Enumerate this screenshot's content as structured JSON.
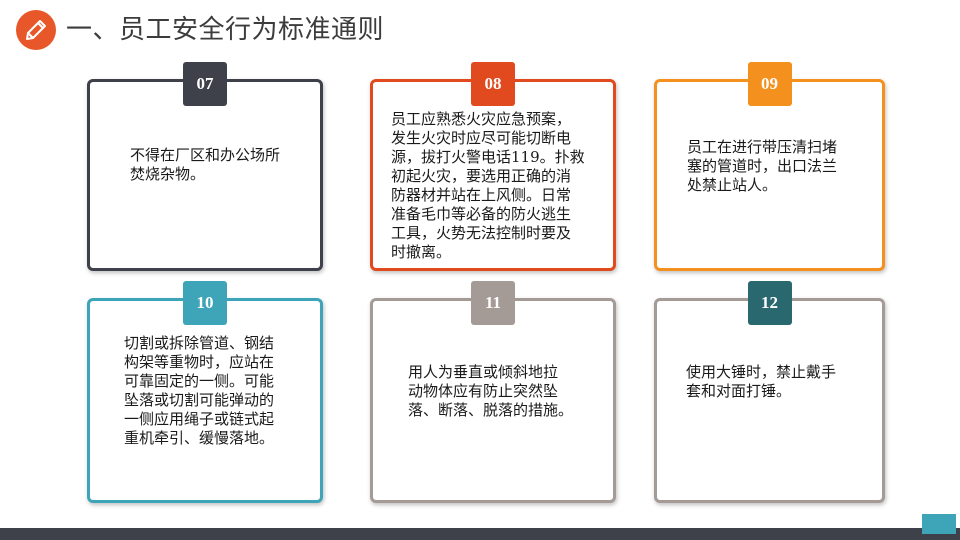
{
  "title": "一、员工安全行为标准通则",
  "colors": {
    "title_icon": "#e8572a",
    "footer": "#3e414a",
    "footer_accent": "#3ea5b8"
  },
  "cards": [
    {
      "number": "07",
      "color": "#3e414a",
      "text": "不得在厂区和办公场所\n焚烧杂物。"
    },
    {
      "number": "08",
      "color": "#e14a1e",
      "text": "员工应熟悉火灾应急预案，\n发生火灾时应尽可能切断电\n源，拔打火警电话119。扑救\n初起火灾，要选用正确的消\n防器材并站在上风侧。日常\n准备毛巾等必备的防火逃生\n工具，火势无法控制时要及\n时撤离。"
    },
    {
      "number": "09",
      "color": "#f4901e",
      "text": "员工在进行带压清扫堵\n塞的管道时，出口法兰\n处禁止站人。"
    },
    {
      "number": "10",
      "color": "#3ea5b8",
      "text": "切割或拆除管道、钢结\n构架等重物时，应站在\n可靠固定的一侧。可能\n坠落或切割可能弹动的\n一侧应用绳子或链式起\n重机牵引、缓慢落地。"
    },
    {
      "number": "11",
      "color": "#a49a96",
      "text": "用人为垂直或倾斜地拉\n动物体应有防止突然坠\n落、断落、脱落的措施。"
    },
    {
      "number": "12",
      "color": "#2a6870",
      "text": "使用大锤时，禁止戴手\n套和对面打锤。"
    }
  ]
}
